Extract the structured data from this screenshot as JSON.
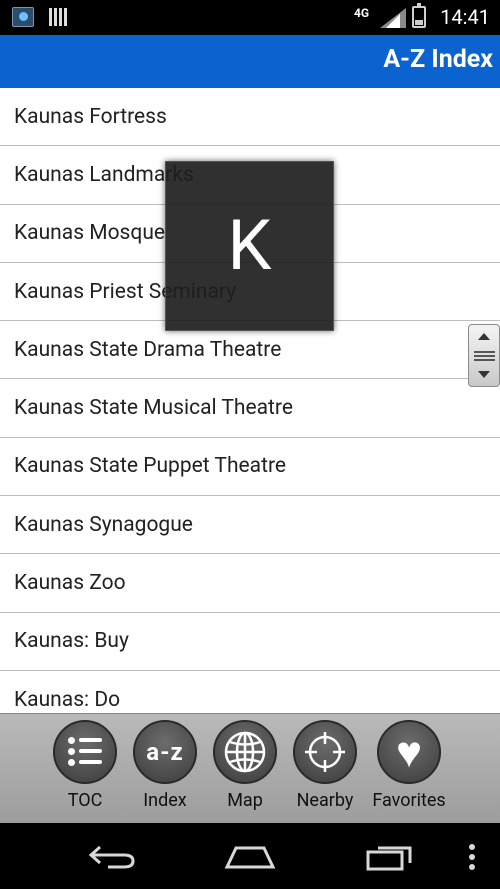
{
  "status_bar": {
    "network": "4G",
    "time": "14:41"
  },
  "header": {
    "title": "A-Z Index"
  },
  "list": {
    "items": [
      "Kaunas Fortress",
      "Kaunas Landmarks",
      "Kaunas Mosque",
      "Kaunas Priest Seminary",
      "Kaunas State Drama Theatre",
      "Kaunas State Musical Theatre",
      "Kaunas State Puppet Theatre",
      "Kaunas Synagogue",
      "Kaunas Zoo",
      "Kaunas: Buy",
      "Kaunas: Do"
    ]
  },
  "section_overlay": {
    "letter": "K"
  },
  "toolbar": {
    "toc_label": "TOC",
    "index_label": "Index",
    "index_icon_text": "a-z",
    "map_label": "Map",
    "nearby_label": "Nearby",
    "favorites_label": "Favorites"
  },
  "icons": {
    "toc": "list-icon",
    "index": "az-icon",
    "map": "globe-icon",
    "nearby": "crosshair-icon",
    "favorites": "heart-icon"
  },
  "colors": {
    "title_bar": "#0a63cf",
    "toolbar": "#b0b0b0"
  }
}
